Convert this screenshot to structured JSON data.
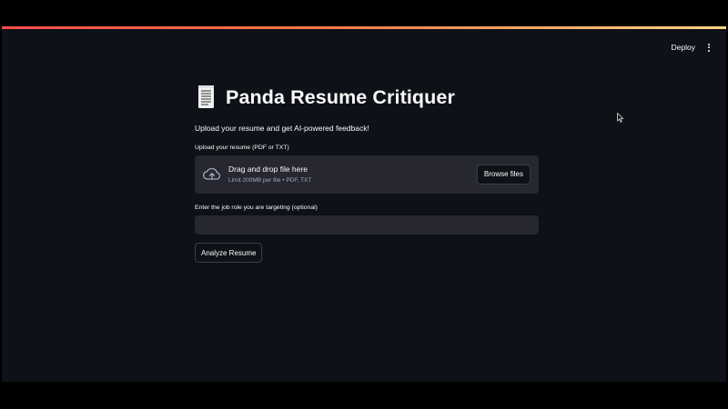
{
  "header": {
    "deploy_label": "Deploy",
    "menu_icon": "vertical-ellipsis-icon"
  },
  "main": {
    "title": "Panda Resume Critiquer",
    "title_icon": "page-with-curl-icon",
    "subtitle": "Upload your resume and get AI-powered feedback!"
  },
  "uploader": {
    "label": "Upload your resume (PDF or TXT)",
    "drop_text": "Drag and drop file here",
    "limit_text": "Limit 200MB per file • PDF, TXT",
    "browse_label": "Browse files",
    "icon": "cloud-upload-icon"
  },
  "job_role": {
    "label": "Enter the job role you are targeting (optional)",
    "value": "",
    "placeholder": ""
  },
  "actions": {
    "analyze_label": "Analyze Resume"
  },
  "colors": {
    "background": "#0e1117",
    "widget_background": "#262730",
    "text": "#fafafa",
    "muted_text": "#a3a8b8",
    "accent_gradient_start": "#ff4b4b",
    "accent_gradient_end": "#ffd580"
  }
}
